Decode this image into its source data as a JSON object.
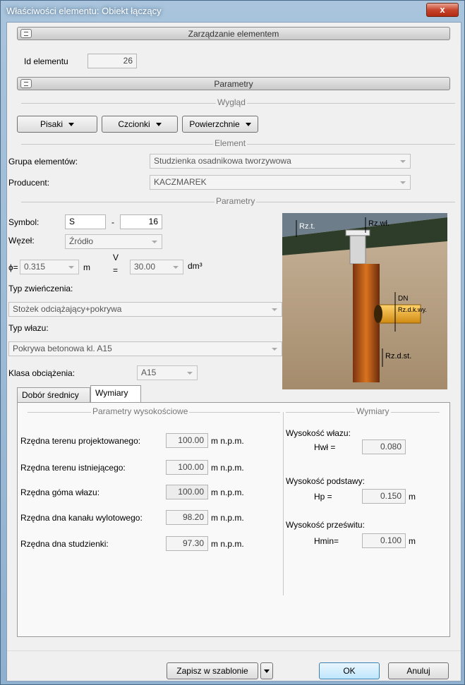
{
  "window": {
    "title": "Właściwości elementu: Obiekt łączący",
    "close_label": "x"
  },
  "management": {
    "header": "Zarządzanie elementem",
    "id_label": "Id elementu",
    "id_value": "26"
  },
  "params_header": "Parametry",
  "appearance": {
    "group_title": "Wygląd",
    "pens_label": "Pisaki",
    "fonts_label": "Czcionki",
    "surfaces_label": "Powierzchnie"
  },
  "element": {
    "group_title": "Element",
    "group_label": "Grupa elementów:",
    "group_value": "Studzienka osadnikowa tworzywowa",
    "producer_label": "Producent:",
    "producer_value": "KACZMAREK"
  },
  "parameters": {
    "group_title": "Parametry",
    "symbol_label": "Symbol:",
    "symbol_value": "S",
    "symbol_sep": "-",
    "symbol_num": "16",
    "node_label": "Węzeł:",
    "node_value": "Źródło",
    "phi_label": "ɸ=",
    "phi_value": "0.315",
    "phi_unit": "m",
    "v_label_top": "V",
    "v_label_bottom": "=",
    "v_value": "30.00",
    "v_unit": "dm³",
    "top_type_label": "Typ zwieńczenia:",
    "top_type_value": "Stożek odciążający+pokrywa",
    "hatch_type_label": "Typ włazu:",
    "hatch_type_value": "Pokrywa betonowa kl. A15",
    "load_class_label": "Klasa obciążenia:",
    "load_class_value": "A15"
  },
  "diagram_labels": {
    "rzt": "Rz.t.",
    "rzwl": "Rz.wł.",
    "dn": "DN",
    "rzdkwy": "Rz.d.k.wy.",
    "rzdst": "Rz.d.st."
  },
  "tabs": [
    {
      "label": "Dobór średnicy"
    },
    {
      "label": "Wymiary"
    }
  ],
  "height_params": {
    "group_title": "Parametry wysokościowe",
    "rows": [
      {
        "label": "Rzędna terenu projektowanego:",
        "value": "100.00",
        "unit": "m n.p.m."
      },
      {
        "label": "Rzędna terenu istniejącego:",
        "value": "100.00",
        "unit": "m n.p.m."
      },
      {
        "label": "Rzędna góma włazu:",
        "value": "100.00",
        "unit": "m n.p.m."
      },
      {
        "label": "Rzędna dna kanału wylotowego:",
        "value": "98.20",
        "unit": "m n.p.m."
      },
      {
        "label": "Rzędna dna studzienki:",
        "value": "97.30",
        "unit": "m n.p.m."
      }
    ]
  },
  "dimensions": {
    "group_title": "Wymiary",
    "hatch_height_label": "Wysokość włazu:",
    "hwl_label": "Hwł =",
    "hwl_value": "0.080",
    "base_height_label": "Wysokość podstawy:",
    "hp_label": "Hp =",
    "hp_value": "0.150",
    "hp_unit": "m",
    "clearance_label": "Wysokość prześwitu:",
    "hmin_label": "Hmin=",
    "hmin_value": "0.100",
    "hmin_unit": "m"
  },
  "footer": {
    "save_template_label": "Zapisz w szablonie",
    "ok_label": "OK",
    "cancel_label": "Anuluj"
  }
}
